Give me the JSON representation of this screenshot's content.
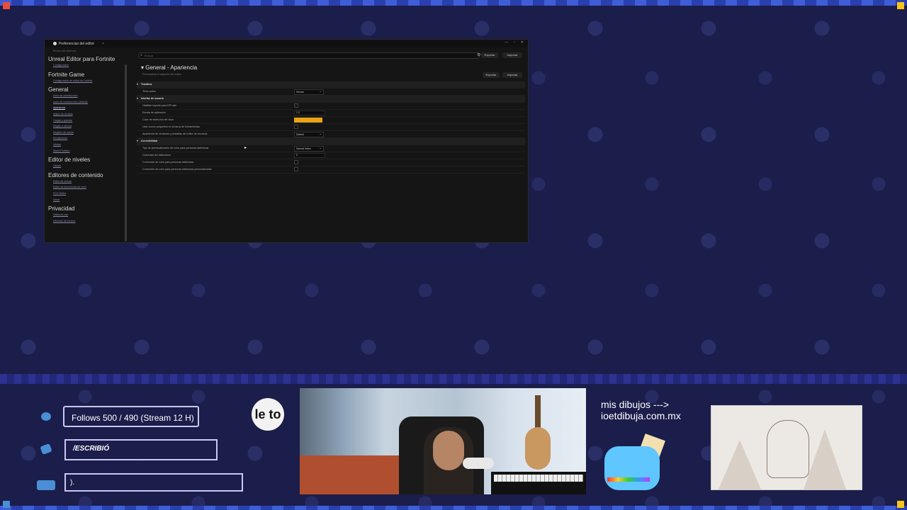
{
  "editor": {
    "tab_title": "Preferencias del editor",
    "tab_close": "×",
    "window_controls": [
      "—",
      "▫",
      "✕"
    ],
    "search_placeholder": "Buscar",
    "export_label": "Exportar",
    "import_label": "Importar",
    "page_title": "General - Apariencia",
    "page_subtitle": "Personaliza el aspecto del editor",
    "sidebar": {
      "cut_item": "Temas del sistema",
      "sections": [
        {
          "title": "Unreal Editor para Fortnite",
          "items": [
            "Configuración"
          ]
        },
        {
          "title": "Fortnite Game",
          "items": [
            "Configuración de editor de Fortnite"
          ]
        },
        {
          "title": "General",
          "items": [
            "Actor de construcción",
            "Actor de construcción (default)",
            "Apariencia",
            "Atajos de teclado",
            "Cargar y guardar",
            "Región e idioma",
            "Registro de salida",
            "Rendimiento",
            "Ventas",
            "World Partition"
          ]
        },
        {
          "title": "Editor de niveles",
          "items": [
            "Ventas"
          ]
        },
        {
          "title": "Editores de contenido",
          "items": [
            "Editor de curvas",
            "Editor de secuencias de nivel",
            "PCG Editor",
            "Verse"
          ]
        },
        {
          "title": "Privacidad",
          "items": [
            "Datos de uso",
            "Informes de errores"
          ]
        }
      ],
      "selected": "Apariencia"
    },
    "rows": [
      {
        "type": "cat",
        "label": "Temática"
      },
      {
        "type": "row",
        "label": "Tema activo",
        "control": "dropdown",
        "value": "Heroes"
      },
      {
        "type": "cat",
        "label": "Interfaz de usuario"
      },
      {
        "type": "row",
        "label": "Habilitar soporte para DPI alto",
        "control": "check",
        "value": "✓"
      },
      {
        "type": "row",
        "label": "Escala de aplicación",
        "control": "number",
        "value": "1.0"
      },
      {
        "type": "row",
        "label": "Color de selección del visor",
        "control": "color",
        "value": ""
      },
      {
        "type": "row",
        "label": "Usar iconos pequeños en la barra de herramientas",
        "control": "check",
        "value": ""
      },
      {
        "type": "row",
        "label": "Apariencia de ventanas y pestañas del editor de recursos",
        "control": "dropdown",
        "value": "Default"
      },
      {
        "type": "cat",
        "label": "Accesibilidad"
      },
      {
        "type": "row",
        "label": "Tipo de previsualización de color para personas daltónicas",
        "control": "dropdown",
        "value": "Normal Vision"
      },
      {
        "type": "row",
        "label": "Gravedad del daltonismo",
        "control": "number",
        "value": "0"
      },
      {
        "type": "row",
        "label": "Corrección de color para personas daltónicas",
        "control": "check",
        "value": ""
      },
      {
        "type": "row",
        "label": "Corrección de color para personas daltónicas personalizadas",
        "control": "check",
        "value": ""
      }
    ],
    "accent_color": "#e8a316"
  },
  "overlay": {
    "follows": "Follows 500 / 490 (Stream 12 H)",
    "wrote_label": "/ESCRIBIÓ",
    "typing_text": ").",
    "logo_text": "le to",
    "promo_line1": "mis dibujos --->",
    "promo_line2": "ioetdibuja.com.mx",
    "accent_color": "#3f5dd6"
  }
}
